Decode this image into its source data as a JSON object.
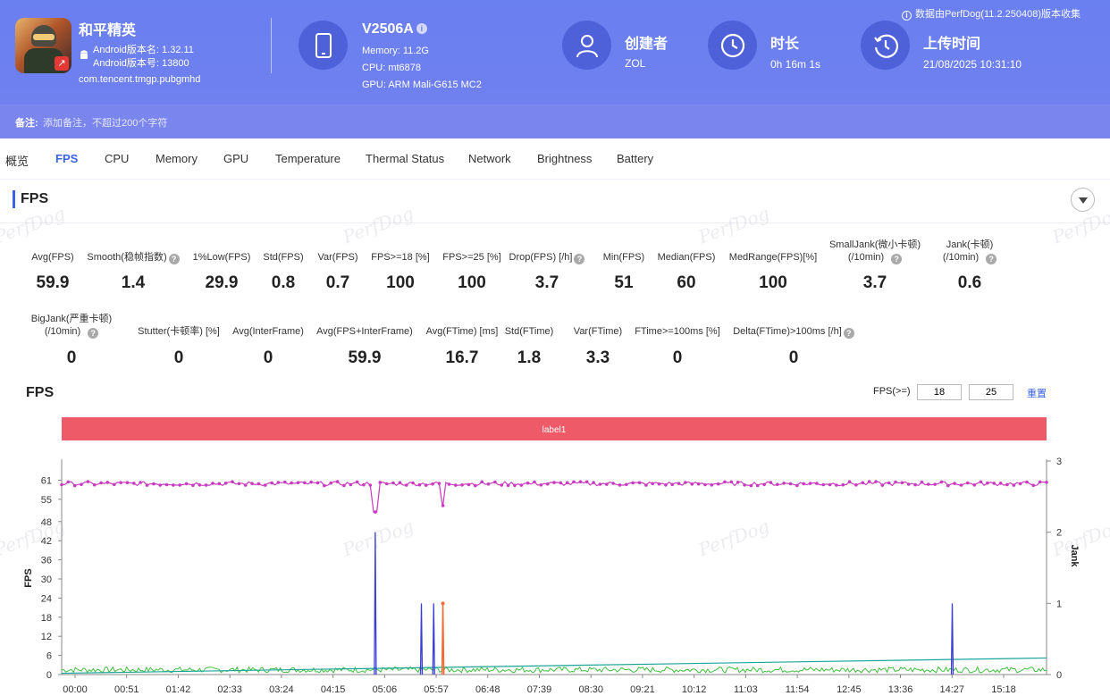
{
  "app": {
    "name": "和平精英",
    "android_version_name": "Android版本名: 1.32.11",
    "android_version_code": "Android版本号: 13800",
    "package": "com.tencent.tmgp.pubgmhd"
  },
  "device": {
    "name": "V2506A",
    "memory": "Memory: 11.2G",
    "cpu": "CPU: mt6878",
    "gpu": "GPU: ARM Mali-G615 MC2"
  },
  "creator": {
    "title": "创建者",
    "value": "ZOL"
  },
  "duration": {
    "title": "时长",
    "value": "0h 16m 1s"
  },
  "upload": {
    "title": "上传时间",
    "value": "21/08/2025 10:31:10"
  },
  "source_note": "数据由PerfDog(11.2.250408)版本收集",
  "note": {
    "label": "备注:",
    "placeholder": "添加备注，不超过200个字符"
  },
  "tabs": [
    "概览",
    "FPS",
    "CPU",
    "Memory",
    "GPU",
    "Temperature",
    "Thermal Status",
    "Network",
    "Brightness",
    "Battery"
  ],
  "active_tab": "FPS",
  "section_title": "FPS",
  "watermark": "PerfDog",
  "stats_row1": [
    {
      "label": "Avg(FPS)",
      "value": "59.9"
    },
    {
      "label": "Smooth(稳帧指数)",
      "value": "1.4",
      "help": true
    },
    {
      "label": "1%Low(FPS)",
      "value": "29.9"
    },
    {
      "label": "Std(FPS)",
      "value": "0.8"
    },
    {
      "label": "Var(FPS)",
      "value": "0.7"
    },
    {
      "label": "FPS>=18 [%]",
      "value": "100"
    },
    {
      "label": "FPS>=25 [%]",
      "value": "100"
    },
    {
      "label": "Drop(FPS) [/h]",
      "value": "3.7",
      "help": true
    },
    {
      "label": "Min(FPS)",
      "value": "51"
    },
    {
      "label": "Median(FPS)",
      "value": "60"
    },
    {
      "label": "MedRange(FPS)[%]",
      "value": "100"
    },
    {
      "label": "SmallJank(微小卡顿)",
      "label2": "(/10min)",
      "value": "3.7",
      "help": true
    },
    {
      "label": "Jank(卡顿)",
      "label2": "(/10min)",
      "value": "0.6",
      "help": true
    }
  ],
  "stats_row2": [
    {
      "label": "BigJank(严重卡顿)",
      "label2": "(/10min)",
      "value": "0",
      "help": true
    },
    {
      "label": "Stutter(卡顿率) [%]",
      "value": "0"
    },
    {
      "label": "Avg(InterFrame)",
      "value": "0"
    },
    {
      "label": "Avg(FPS+InterFrame)",
      "value": "59.9"
    },
    {
      "label": "Avg(FTime) [ms]",
      "value": "16.7"
    },
    {
      "label": "Std(FTime)",
      "value": "1.8"
    },
    {
      "label": "Var(FTime)",
      "value": "3.3"
    },
    {
      "label": "FTime>=100ms [%]",
      "value": "0"
    },
    {
      "label": "Delta(FTime)>100ms [/h]",
      "value": "0",
      "help": true
    }
  ],
  "chart_controls": {
    "title": "FPS",
    "fps_ge_label": "FPS(>=)",
    "threshold1": "18",
    "threshold2": "25",
    "reset_label": "重置"
  },
  "colors": {
    "header": "#6a7ff0",
    "accent": "#3b63e6",
    "label_band": "#ee5a67",
    "fps_line": "#c93bc0",
    "jank_line": "#3b3fd0",
    "bigjank_line": "#ef6a35",
    "ftime_line": "#3fbf3f",
    "trend_line": "#1aa59a"
  },
  "chart_data": {
    "type": "line",
    "band_label": "label1",
    "x_ticks": [
      "00:00",
      "00:51",
      "01:42",
      "02:33",
      "03:24",
      "04:15",
      "05:06",
      "05:57",
      "06:48",
      "07:39",
      "08:30",
      "09:21",
      "10:12",
      "11:03",
      "11:54",
      "12:45",
      "13:36",
      "14:27",
      "15:18"
    ],
    "x_range_sec": [
      0,
      961
    ],
    "y_left": {
      "label": "FPS",
      "ticks": [
        0,
        6,
        12,
        18,
        24,
        30,
        36,
        42,
        48,
        55,
        61
      ],
      "ylim": [
        0,
        67
      ]
    },
    "y_right": {
      "label": "Jank",
      "ticks": [
        0,
        1,
        2,
        3
      ],
      "ylim": [
        0,
        3
      ]
    },
    "series": [
      {
        "axis": "left",
        "base": 59.9,
        "dips": [
          {
            "t": 306,
            "v": 51
          },
          {
            "t": 372,
            "v": 53
          }
        ]
      },
      {
        "axis": "right",
        "spikes": [
          {
            "t": 306,
            "v": 2.0
          },
          {
            "t": 351,
            "v": 1.0
          },
          {
            "t": 363,
            "v": 1.0
          },
          {
            "t": 869,
            "v": 1.0
          }
        ]
      },
      {
        "axis": "right",
        "spikes": [
          {
            "t": 372,
            "v": 1.0
          }
        ]
      },
      {
        "axis": "left",
        "base": 1.5
      },
      {
        "axis": "left",
        "start": 0.4,
        "end": 5.2
      }
    ]
  }
}
